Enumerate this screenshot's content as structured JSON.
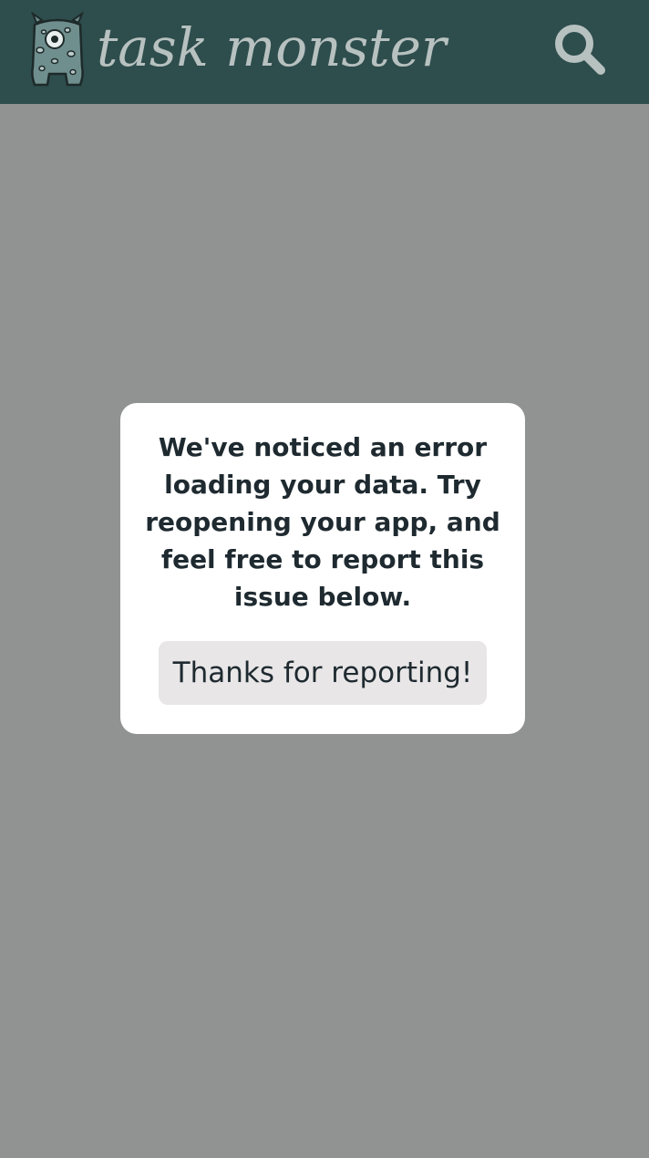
{
  "header": {
    "app_title": "task monster",
    "logo_icon": "monster-logo-icon",
    "search_icon": "search-icon",
    "background_color": "#2e4d4d",
    "title_color": "#b7c1c0"
  },
  "dialog": {
    "message": "We've noticed an error loading your data. Try reopening your app, and feel free to report this issue below.",
    "button_label": "Thanks for reporting!"
  },
  "colors": {
    "overlay": "#919392",
    "dialog_background": "#ffffff",
    "button_background": "#e8e6e7",
    "text": "#1e2a30"
  }
}
